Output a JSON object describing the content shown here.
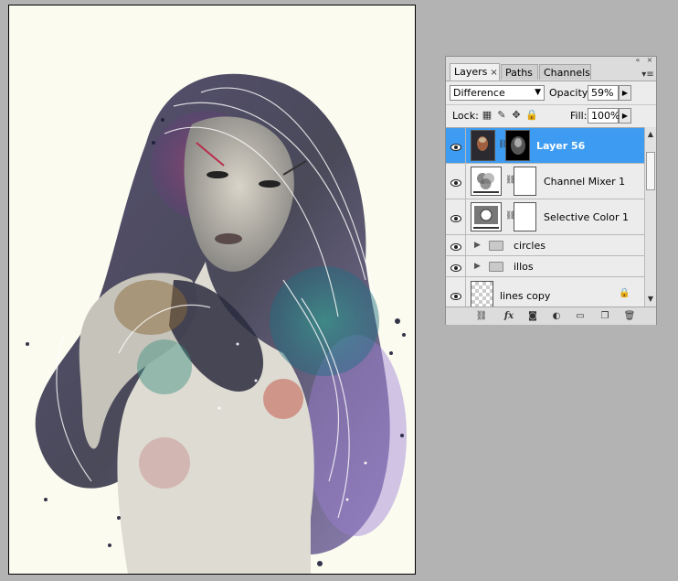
{
  "panel": {
    "tabs": [
      {
        "label": "Layers",
        "active": true
      },
      {
        "label": "Paths",
        "active": false
      },
      {
        "label": "Channels",
        "active": false
      }
    ],
    "blend_mode": "Difference",
    "opacity_label": "Opacity:",
    "opacity_value": "59%",
    "lock_label": "Lock:",
    "fill_label": "Fill:",
    "fill_value": "100%",
    "layers": [
      {
        "name": "Layer 56",
        "selected": true,
        "kind": "image-with-mask"
      },
      {
        "name": "Channel Mixer 1",
        "selected": false,
        "kind": "adjustment"
      },
      {
        "name": "Selective Color 1",
        "selected": false,
        "kind": "adjustment"
      },
      {
        "name": "circles",
        "selected": false,
        "kind": "group"
      },
      {
        "name": "illos",
        "selected": false,
        "kind": "group"
      },
      {
        "name": "lines copy",
        "selected": false,
        "kind": "transparent",
        "locked": true
      }
    ],
    "footer_icons": [
      "link-layers-icon",
      "fx-icon",
      "add-mask-icon",
      "adjustment-layer-icon",
      "new-group-icon",
      "new-layer-icon",
      "trash-icon"
    ],
    "colors": {
      "selection": "#3d9cf2",
      "panel": "#dcdcdc"
    }
  },
  "canvas": {
    "background": "#fbfbf0"
  }
}
